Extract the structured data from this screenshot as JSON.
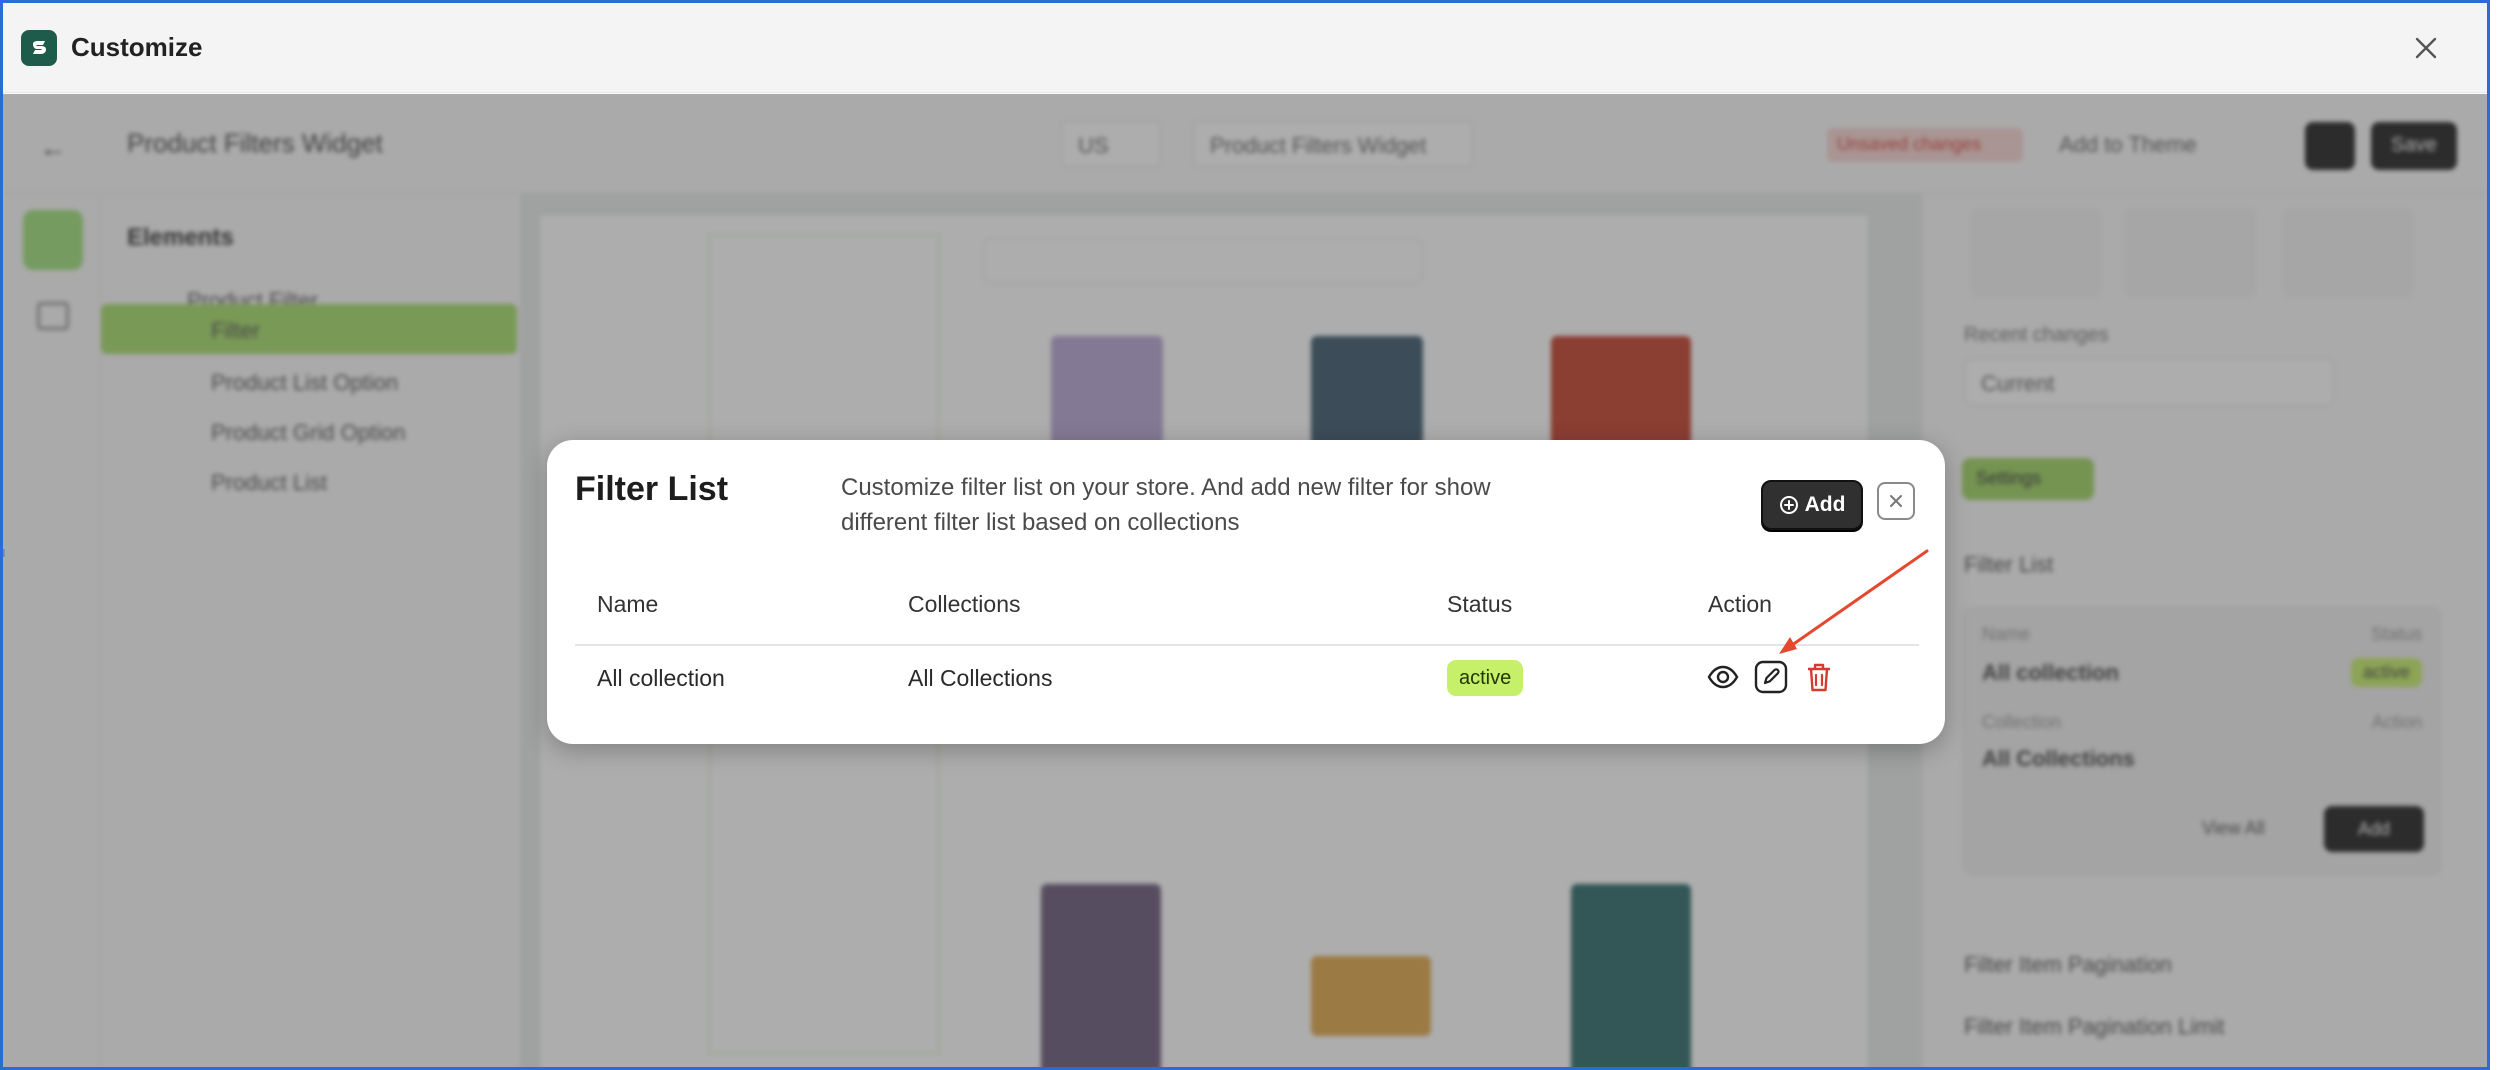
{
  "window": {
    "title": "Customize",
    "close_icon": "close-icon",
    "logo_icon": "app-logo-icon"
  },
  "background": {
    "page_title": "Product Filters Widget",
    "theme_select": "US",
    "template_select": "Product Filters Widget",
    "unsaved_badge": "Unsaved changes",
    "add_to_theme": "Add to Theme",
    "save": "Save",
    "sidebar_heading": "Elements",
    "tree": [
      "Product Filter",
      "Filter",
      "Product List Option",
      "Product Grid Option",
      "Product List"
    ],
    "right_panel": {
      "recent_changes": "Recent changes",
      "current": "Current",
      "settings": "Settings",
      "filter_list": "Filter List",
      "name_label": "Name",
      "status_label": "Status",
      "name_value": "All collection",
      "status_value": "active",
      "collection_label": "Collection",
      "action_label": "Action",
      "collection_value": "All Collections",
      "view_all": "View All",
      "add": "Add",
      "pagination": "Filter Item Pagination",
      "pagination_limit": "Filter Item Pagination Limit"
    }
  },
  "modal": {
    "title": "Filter List",
    "description": "Customize filter list on your store. And add new filter for show different filter list based on collections",
    "add_button": "Add",
    "columns": [
      "Name",
      "Collections",
      "Status",
      "Action"
    ],
    "rows": [
      {
        "name": "All collection",
        "collections": "All Collections",
        "status": "active"
      }
    ],
    "actions": [
      "eye-icon",
      "edit-icon",
      "trash-icon"
    ],
    "colors": {
      "status_active_bg": "#c7f06a",
      "add_button_bg": "#303030",
      "delete_icon": "#d63a2f",
      "annotation_arrow": "#e5482f"
    }
  }
}
